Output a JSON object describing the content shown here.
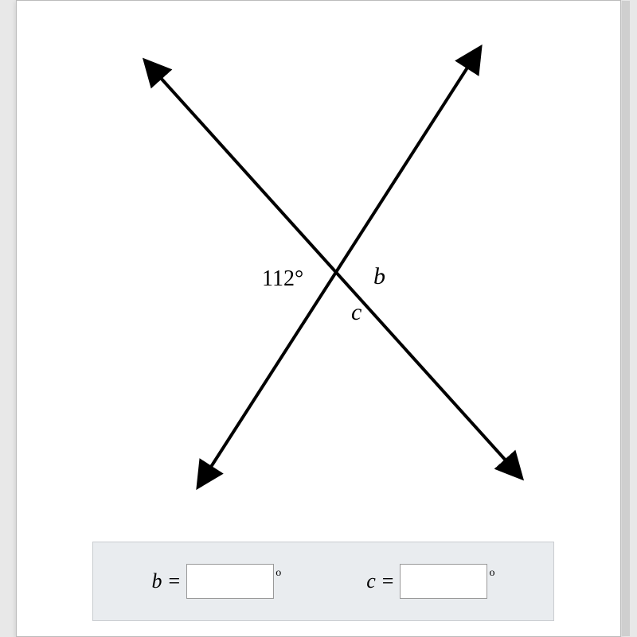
{
  "chart_data": {
    "type": "diagram",
    "description": "Two intersecting lines forming vertical and supplementary angles",
    "given_angle": {
      "label": "112°",
      "position": "left"
    },
    "unknown_angles": [
      {
        "var": "b",
        "position": "right",
        "relation": "vertical to 112°"
      },
      {
        "var": "c",
        "position": "bottom",
        "relation": "supplementary to 112°"
      }
    ]
  },
  "labels": {
    "angle_given": "112°",
    "angle_b": "b",
    "angle_c": "c"
  },
  "answers": {
    "b": {
      "var": "b",
      "equals": "=",
      "unit": "o",
      "value": ""
    },
    "c": {
      "var": "c",
      "equals": "=",
      "unit": "o",
      "value": ""
    }
  }
}
